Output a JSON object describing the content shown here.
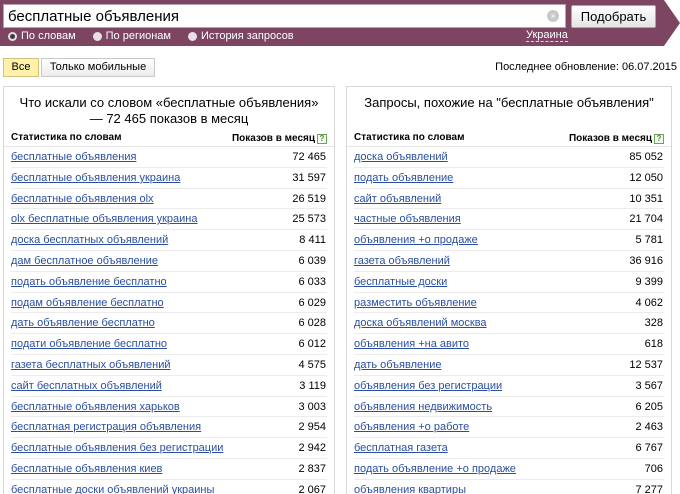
{
  "search": {
    "value": "бесплатные объявления",
    "clear_glyph": "×",
    "submit_label": "Подобрать"
  },
  "modes": [
    {
      "label": "По словам",
      "selected": true
    },
    {
      "label": "По регионам",
      "selected": false
    },
    {
      "label": "История запросов",
      "selected": false
    }
  ],
  "region": "Украина",
  "filters": {
    "all_label": "Все",
    "mobile_label": "Только мобильные"
  },
  "last_update": "Последнее обновление: 06.07.2015",
  "left": {
    "title": "Что искали со словом «бесплатные объявления» — 72 465 показов в месяц",
    "col_phrase": "Статистика по словам",
    "col_count": "Показов в месяц",
    "help_glyph": "?",
    "rows": [
      {
        "phrase": "бесплатные объявления",
        "count": "72 465"
      },
      {
        "phrase": "бесплатные объявления украина",
        "count": "31 597"
      },
      {
        "phrase": "бесплатные объявления olx",
        "count": "26 519"
      },
      {
        "phrase": "olx бесплатные объявления украина",
        "count": "25 573"
      },
      {
        "phrase": "доска бесплатных объявлений",
        "count": "8 411"
      },
      {
        "phrase": "дам бесплатное объявление",
        "count": "6 039"
      },
      {
        "phrase": "подать объявление бесплатно",
        "count": "6 033"
      },
      {
        "phrase": "подам объявление бесплатно",
        "count": "6 029"
      },
      {
        "phrase": "дать объявление бесплатно",
        "count": "6 028"
      },
      {
        "phrase": "подати объявление бесплатно",
        "count": "6 012"
      },
      {
        "phrase": "газета бесплатных объявлений",
        "count": "4 575"
      },
      {
        "phrase": "сайт бесплатных объявлений",
        "count": "3 119"
      },
      {
        "phrase": "бесплатные объявления харьков",
        "count": "3 003"
      },
      {
        "phrase": "бесплатная регистрация объявления",
        "count": "2 954"
      },
      {
        "phrase": "бесплатные объявления без регистрации",
        "count": "2 942"
      },
      {
        "phrase": "бесплатные объявления киев",
        "count": "2 837"
      },
      {
        "phrase": "бесплатные доски объявлений украины",
        "count": "2 067"
      }
    ]
  },
  "right": {
    "title": "Запросы, похожие на \"бесплатные объявления\"",
    "col_phrase": "Статистика по словам",
    "col_count": "Показов в месяц",
    "help_glyph": "?",
    "rows": [
      {
        "phrase": "доска объявлений",
        "count": "85 052"
      },
      {
        "phrase": "подать объявление",
        "count": "12 050"
      },
      {
        "phrase": "сайт объявлений",
        "count": "10 351"
      },
      {
        "phrase": "частные объявления",
        "count": "21 704"
      },
      {
        "phrase": "объявления +о продаже",
        "count": "5 781"
      },
      {
        "phrase": "газета объявлений",
        "count": "36 916"
      },
      {
        "phrase": "бесплатные доски",
        "count": "9 399"
      },
      {
        "phrase": "разместить объявление",
        "count": "4 062"
      },
      {
        "phrase": "доска объявлений москва",
        "count": "328"
      },
      {
        "phrase": "объявления +на авито",
        "count": "618"
      },
      {
        "phrase": "дать объявление",
        "count": "12 537"
      },
      {
        "phrase": "объявления без регистрации",
        "count": "3 567"
      },
      {
        "phrase": "объявления недвижимость",
        "count": "6 205"
      },
      {
        "phrase": "объявления +о работе",
        "count": "2 463"
      },
      {
        "phrase": "бесплатная газета",
        "count": "6 767"
      },
      {
        "phrase": "подать объявление +о продаже",
        "count": "706"
      },
      {
        "phrase": "объявления квартиры",
        "count": "7 277"
      }
    ]
  },
  "colors": {
    "header": "#7d4562",
    "link": "#2a4fa0",
    "active_chip": "#fff1a8"
  }
}
